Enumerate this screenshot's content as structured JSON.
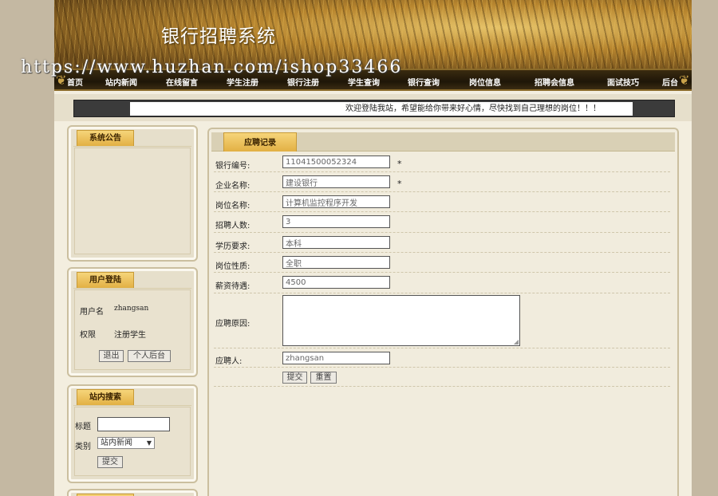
{
  "site_title": "银行招聘系统",
  "watermark": "https://www.huzhan.com/ishop33466",
  "nav": [
    "首页",
    "站内新闻",
    "在线留言",
    "学生注册",
    "银行注册",
    "学生查询",
    "银行查询",
    "岗位信息",
    "招聘会信息",
    "面试技巧",
    "后台"
  ],
  "marquee": "欢迎登陆我站，希望能给你带来好心情，尽快找到自己理想的岗位！！！",
  "notice": {
    "title": "系统公告"
  },
  "login": {
    "title": "用户登陆",
    "user_label": "用户名",
    "user_value": "zhangsan",
    "role_label": "权限",
    "role_value": "注册学生",
    "logout": "退出",
    "backend": "个人后台"
  },
  "search": {
    "title": "站内搜索",
    "title_label": "标题",
    "title_value": "",
    "type_label": "类别",
    "type_value": "站内新闻",
    "submit": "提交"
  },
  "form": {
    "title": "应聘记录",
    "fields": {
      "bank_no": {
        "label": "银行编号:",
        "value": "11041500052324"
      },
      "company": {
        "label": "企业名称:",
        "value": "建设银行"
      },
      "position": {
        "label": "岗位名称:",
        "value": "计算机监控程序开发"
      },
      "count": {
        "label": "招聘人数:",
        "value": "3"
      },
      "education": {
        "label": "学历要求:",
        "value": "本科"
      },
      "nature": {
        "label": "岗位性质:",
        "value": "全职"
      },
      "salary": {
        "label": "薪资待遇:",
        "value": "4500"
      },
      "reason": {
        "label": "应聘原因:",
        "value": ""
      },
      "applicant": {
        "label": "应聘人:",
        "value": "zhangsan"
      }
    },
    "required_mark": "*",
    "submit": "提交",
    "reset": "重置"
  }
}
